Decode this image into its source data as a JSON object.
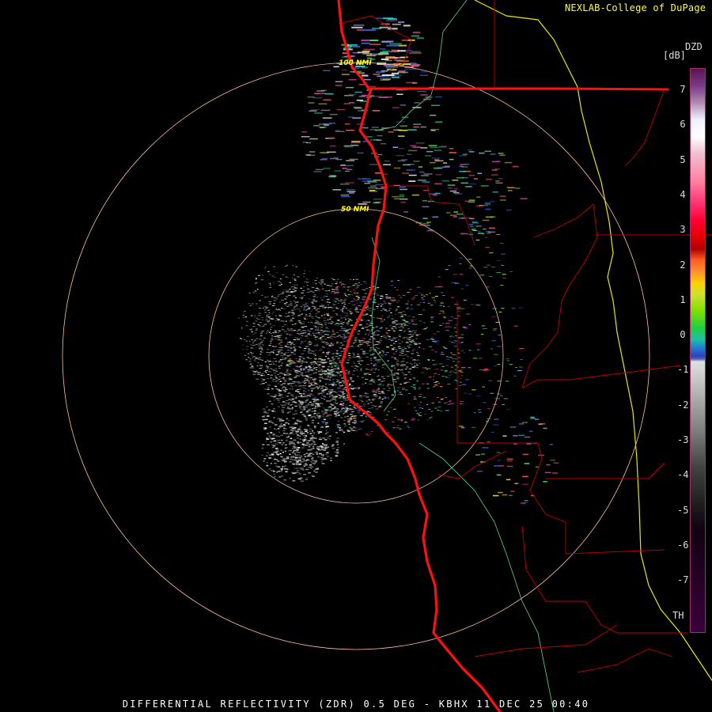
{
  "header": {
    "credit": "NEXLAB-College of DuPage",
    "config_icon": "config-arrow-icon"
  },
  "legend": {
    "product_code": "DZD",
    "units": "[dB]",
    "scale_labels": [
      "7",
      "6",
      "5",
      "4",
      "3",
      "2",
      "1",
      "0",
      "-1",
      "-2",
      "-3",
      "-4",
      "-5",
      "-6",
      "-7",
      "TH"
    ]
  },
  "range_rings": [
    {
      "label": "100 NMI",
      "range_nmi": 100
    },
    {
      "label": "50 NMI",
      "range_nmi": 50
    }
  ],
  "footer": {
    "title": "DIFFERENTIAL REFLECTIVITY (ZDR) 0.5 DEG - KBHX 11 DEC 25 00:40"
  },
  "colors": {
    "background": "#000000",
    "ring": "#ffbfa0",
    "coastline": "#ff1010",
    "county": "#c00000",
    "state_line": "#e8e800",
    "river": "#50c080",
    "credit": "#ffff33"
  }
}
